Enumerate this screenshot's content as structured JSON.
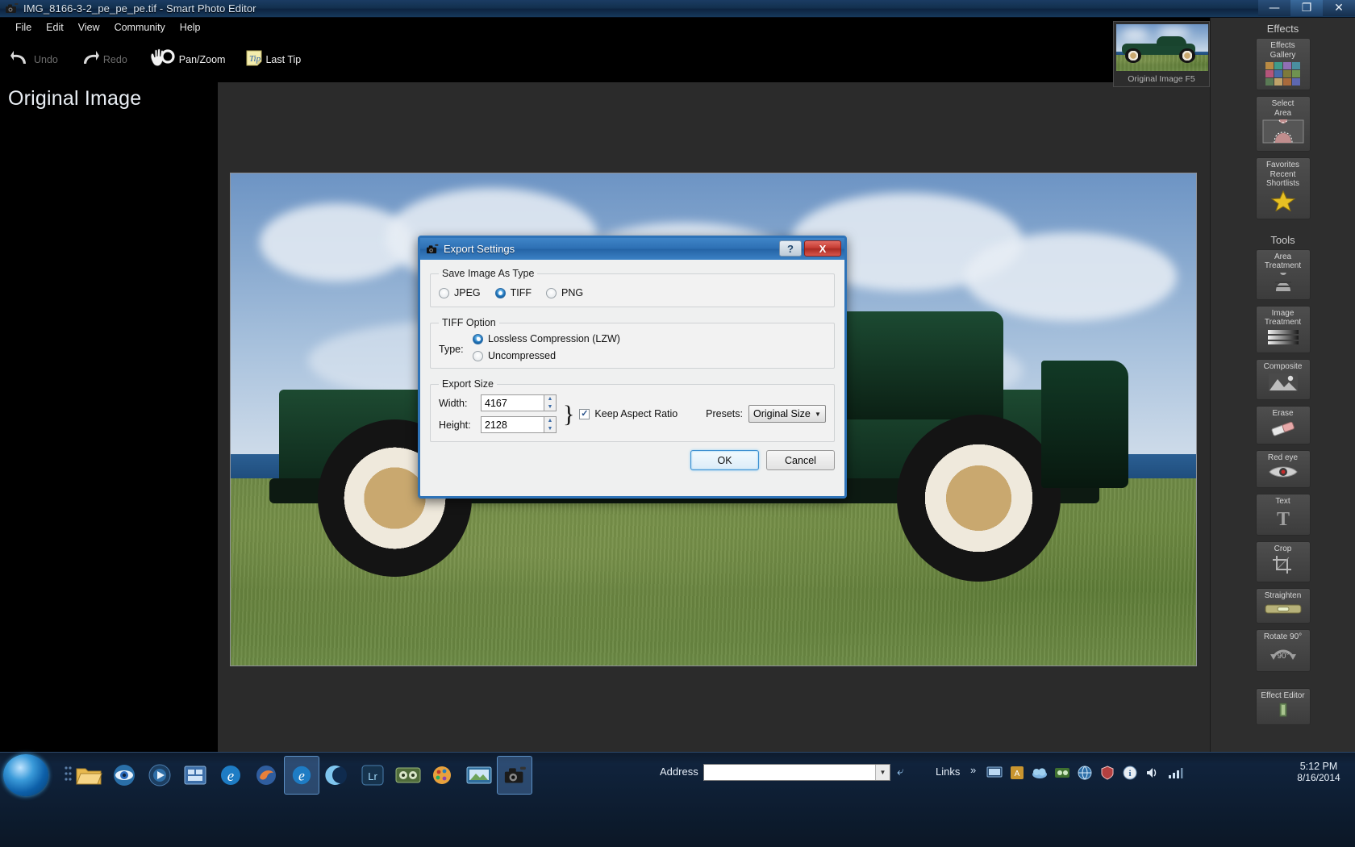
{
  "window": {
    "title": "IMG_8166-3-2_pe_pe_pe.tif - Smart Photo Editor",
    "app_icon": "camera-icon",
    "minimize": "—",
    "maximize": "❐",
    "close": "✕"
  },
  "menubar": {
    "items": [
      "File",
      "Edit",
      "View",
      "Community",
      "Help"
    ]
  },
  "toolbar": {
    "undo": "Undo",
    "redo": "Redo",
    "pan_zoom": "Pan/Zoom",
    "last_tip": "Last Tip",
    "tip_icon_text": "Tip"
  },
  "workspace": {
    "page_title": "Original Image"
  },
  "preview": {
    "label": "Original Image F5"
  },
  "right_panel": {
    "effects_title": "Effects",
    "effects_items": [
      {
        "label": "Effects\nGallery",
        "icon": "swatch-grid-icon"
      },
      {
        "label": "Select\nArea",
        "icon": "person-silhouette-icon"
      },
      {
        "label": "Favorites\nRecent\nShortlists",
        "icon": "star-icon"
      }
    ],
    "tools_title": "Tools",
    "tools_items": [
      {
        "label": "Area\nTreatment",
        "icon": "person-adjust-icon"
      },
      {
        "label": "Image\nTreatment",
        "icon": "gradient-bars-icon"
      },
      {
        "label": "Composite",
        "icon": "mountain-picture-icon"
      },
      {
        "label": "Erase",
        "icon": "eraser-icon"
      },
      {
        "label": "Red eye",
        "icon": "eye-icon"
      },
      {
        "label": "Text",
        "icon": "text-t-icon"
      },
      {
        "label": "Crop",
        "icon": "crop-icon"
      },
      {
        "label": "Straighten",
        "icon": "spirit-level-icon"
      },
      {
        "label": "Rotate 90°",
        "icon": "rotate-icon"
      }
    ],
    "effect_editor": {
      "label": "Effect Editor",
      "icon": "editor-icon"
    },
    "rotate_badge": "90°"
  },
  "dialog": {
    "title": "Export Settings",
    "icon": "camera-icon",
    "help_button": "?",
    "close_button": "X",
    "groups": {
      "save_type": {
        "legend": "Save Image As Type",
        "options": [
          {
            "label": "JPEG",
            "selected": false
          },
          {
            "label": "TIFF",
            "selected": true
          },
          {
            "label": "PNG",
            "selected": false
          }
        ]
      },
      "tiff_option": {
        "legend": "TIFF Option",
        "type_label": "Type:",
        "options": [
          {
            "label": "Lossless Compression (LZW)",
            "selected": true
          },
          {
            "label": "Uncompressed",
            "selected": false
          }
        ]
      },
      "export_size": {
        "legend": "Export Size",
        "width_label": "Width:",
        "width_value": "4167",
        "height_label": "Height:",
        "height_value": "2128",
        "keep_aspect_label": "Keep Aspect Ratio",
        "keep_aspect_checked": true,
        "presets_label": "Presets:",
        "presets_value": "Original Size"
      }
    },
    "buttons": {
      "ok": "OK",
      "cancel": "Cancel"
    }
  },
  "taskbar": {
    "address_label": "Address",
    "address_value": "",
    "links_label": "Links",
    "links_chevron": "»",
    "clock_time": "5:12 PM",
    "clock_date": "8/16/2014"
  },
  "colors": {
    "accent_blue": "#2e73b8",
    "title_blue": "#2d6fb3",
    "close_red": "#c33a31",
    "panel_gray": "#2e2e2e",
    "dialog_bg": "#eff0f0"
  }
}
